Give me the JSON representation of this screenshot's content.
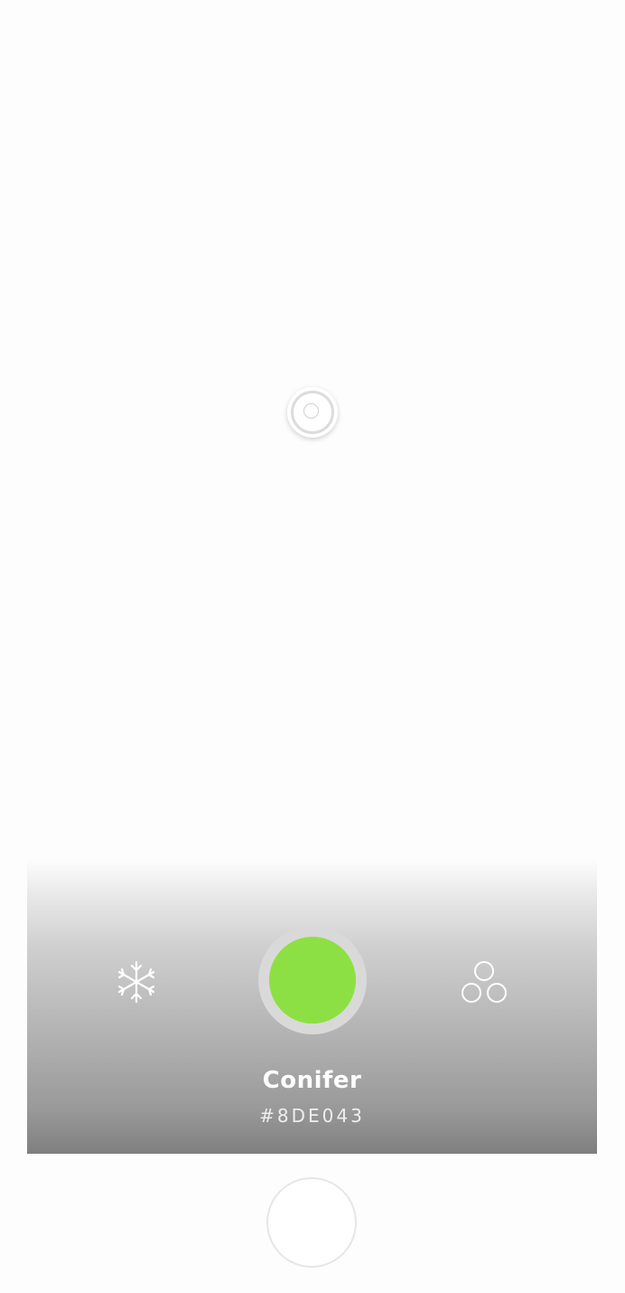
{
  "camera": {
    "focus_icon": "focus-reticle-icon"
  },
  "panel": {
    "left_icon": "snowflake-icon",
    "right_icon": "palette-circles-icon",
    "color": {
      "name": "Conifer",
      "hex": "#8DE043",
      "swatch_color": "#8DE043"
    }
  },
  "shutter": {
    "icon": "shutter-button-icon"
  }
}
